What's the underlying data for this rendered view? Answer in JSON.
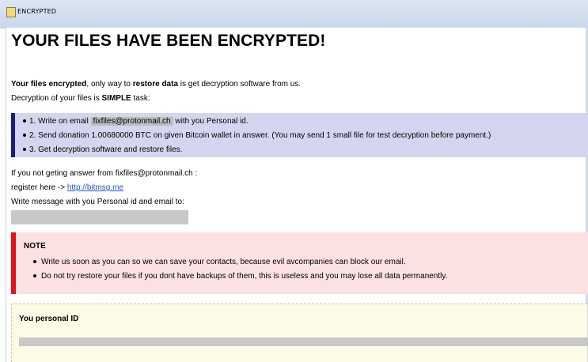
{
  "window": {
    "title": "ENCRYPTED"
  },
  "headline": "YOUR FILES HAVE BEEN ENCRYPTED!",
  "intro": {
    "line1_bold1": "Your files encrypted",
    "line1_mid": ", only way to ",
    "line1_bold2": "restore data",
    "line1_end": " is get decryption software from us.",
    "line2_start": "Decryption of your files is ",
    "line2_bold": "SIMPLE",
    "line2_end": " task:"
  },
  "steps": {
    "step1_prefix": "1. Write on email ",
    "step1_email": "fixfiles@protonmail.ch",
    "step1_suffix": " with you Personal id.",
    "step2": "2. Send donation 1.00680000 BTC on given Bitcoin wallet in answer. (You may send 1 small file for test decryption before payment.)",
    "step3": "3. Get decryption software and restore files."
  },
  "contact": {
    "line1": "If you not geting answer from fixfiles@protonmail.ch :",
    "register_prefix": "register here -> ",
    "register_link": "http://bitmsg.me",
    "line3": "Write message with you Personal id and email to:"
  },
  "note": {
    "title": "NOTE",
    "items": [
      "Write us soon as you can so we can save your contacts, because evil avcompanies can block our email.",
      "Do not try restore your files if you dont have backups of them, this is useless and you may lose all data permanently."
    ]
  },
  "personal_id": {
    "title": "You personal ID"
  },
  "colors": {
    "steps_bg": "#d4d6ef",
    "steps_accent": "#1a1a8c",
    "note_bg": "#fbe1e1",
    "note_accent": "#e0141b",
    "id_bg": "#fdfbe6",
    "link": "#1d57c4"
  },
  "icons": {
    "window_icon": "lock-file-icon",
    "bullet": "bullet-dot"
  }
}
